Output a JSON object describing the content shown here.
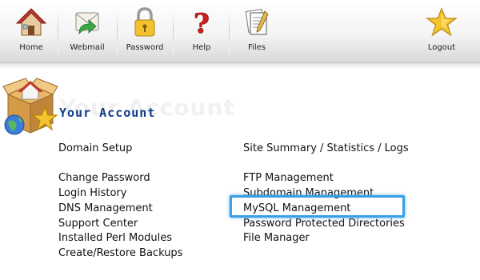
{
  "toolbar": {
    "items": [
      {
        "label": "Home",
        "icon": "home-icon"
      },
      {
        "label": "Webmail",
        "icon": "webmail-icon"
      },
      {
        "label": "Password",
        "icon": "padlock-icon"
      },
      {
        "label": "Help",
        "icon": "question-mark-icon"
      },
      {
        "label": "Files",
        "icon": "files-icon"
      },
      {
        "label": "Logout",
        "icon": "star-icon"
      }
    ]
  },
  "page": {
    "title": "Your Account",
    "ghost_title": "Your Account",
    "icon": "account-box-globe-star-icon"
  },
  "left_links": [
    "Domain Setup",
    "Change Password",
    "Login History",
    "DNS Management",
    "Support Center",
    "Installed Perl Modules",
    "Create/Restore Backups"
  ],
  "right_links": [
    "Site Summary / Statistics / Logs",
    "FTP Management",
    "Subdomain Management",
    "MySQL Management",
    "Password Protected Directories",
    "File Manager"
  ],
  "highlighted_link": "MySQL Management",
  "colors": {
    "title": "#123c8a",
    "highlight": "#3b9fe6",
    "text": "#111111"
  }
}
